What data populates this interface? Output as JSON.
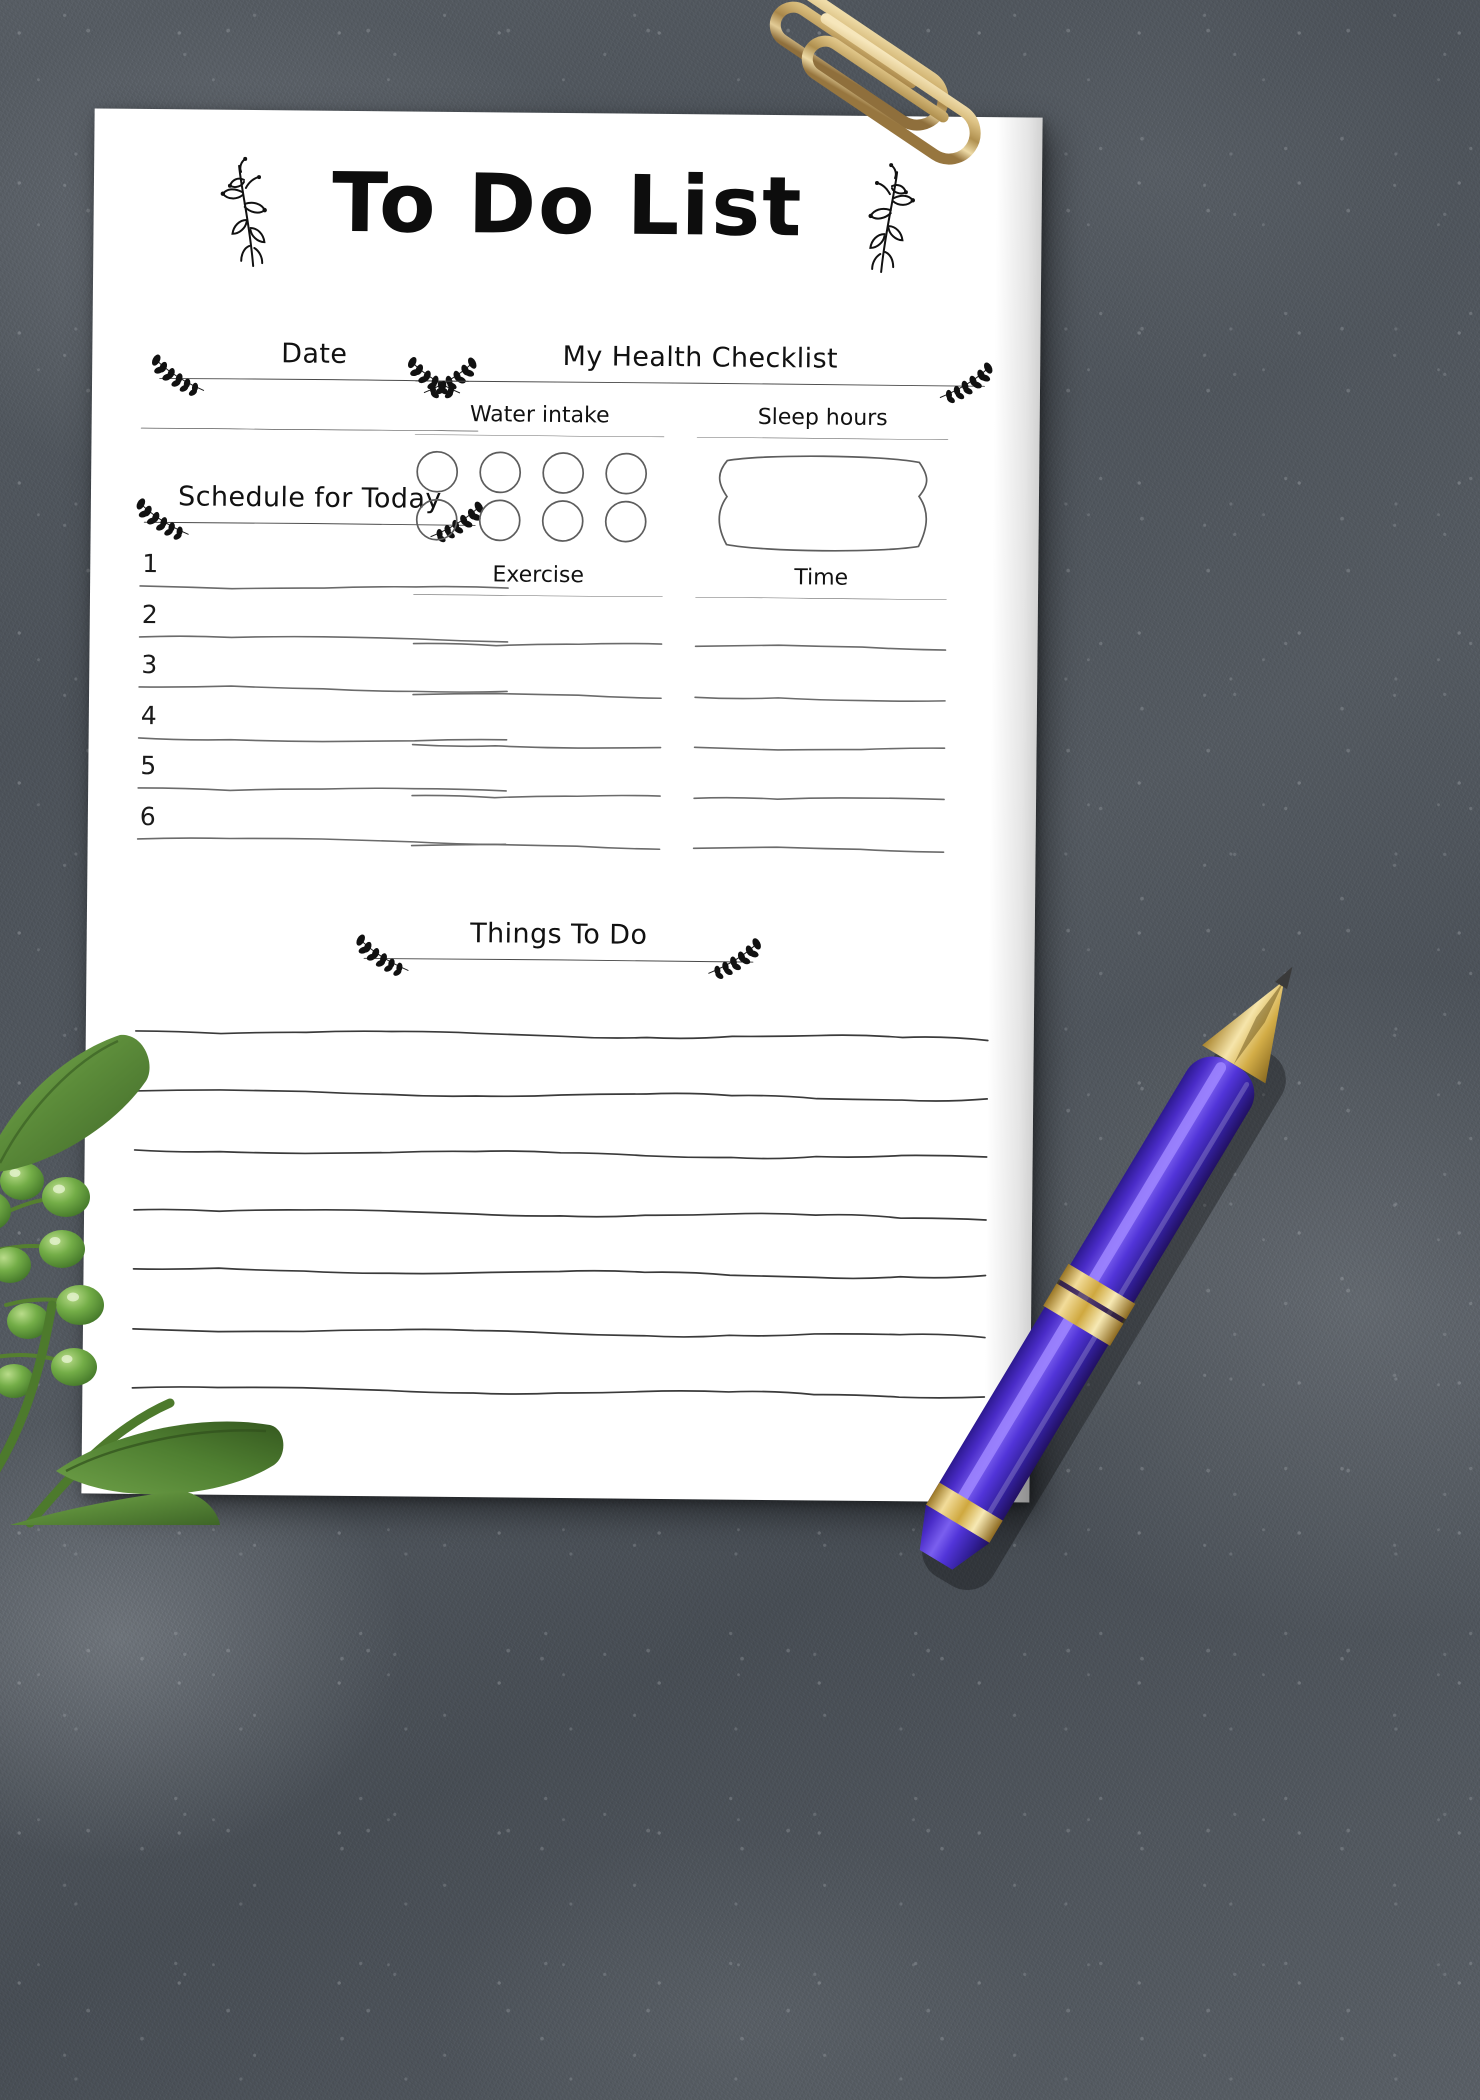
{
  "scene": {
    "background_description": "dark grey slate texture",
    "background_color": "#4f555c",
    "paper_color": "#ffffff",
    "objects": [
      {
        "name": "gold-paperclip",
        "count": 2,
        "color": "#c9a861"
      },
      {
        "name": "green-plant-sprig",
        "color": "#5f8a3f"
      },
      {
        "name": "purple-gold-pen",
        "body_color": "#4e2fd4",
        "trim_color": "#d8ae3a"
      }
    ]
  },
  "document": {
    "title": "To Do List",
    "title_decoration": "botanical-sprig",
    "sections": {
      "date": {
        "heading": "Date",
        "decoration": "laurel-branch",
        "line_count": 1
      },
      "health": {
        "heading": "My Health Checklist",
        "decoration": "laurel-branch",
        "water": {
          "label": "Water intake",
          "circle_count": 8,
          "rows": 2,
          "per_row": 4
        },
        "sleep": {
          "label": "Sleep hours",
          "field_shape": "wavy-rounded-box"
        },
        "table": {
          "columns": [
            "Exercise",
            "Time"
          ],
          "row_count": 5
        }
      },
      "schedule": {
        "heading": "Schedule for Today",
        "decoration": "laurel-branch",
        "numbers": [
          "1",
          "2",
          "3",
          "4",
          "5",
          "6"
        ]
      },
      "things_to_do": {
        "heading": "Things To Do",
        "decoration": "laurel-branch",
        "line_count": 7
      }
    }
  }
}
